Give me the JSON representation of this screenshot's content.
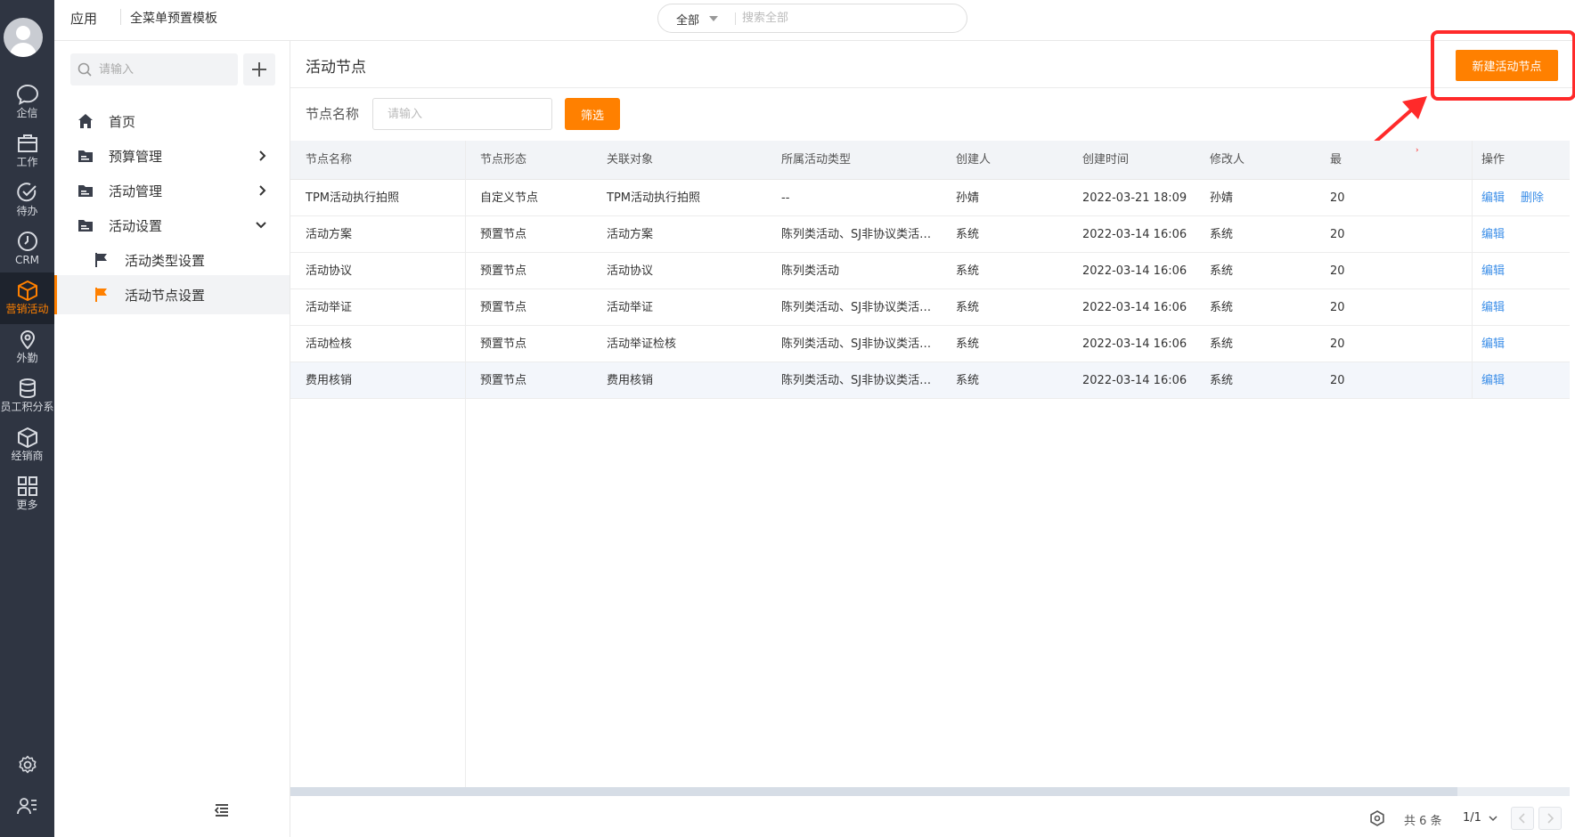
{
  "rail": {
    "items": [
      {
        "label": "企信",
        "icon": "chat-icon"
      },
      {
        "label": "工作",
        "icon": "briefcase-icon"
      },
      {
        "label": "待办",
        "icon": "check-circle-icon"
      },
      {
        "label": "CRM",
        "icon": "clock-icon"
      },
      {
        "label": "营销活动",
        "icon": "cube-icon",
        "active": true
      },
      {
        "label": "外勤",
        "icon": "location-pin-icon"
      },
      {
        "label": "员工积分系",
        "icon": "database-icon"
      },
      {
        "label": "经销商",
        "icon": "box-icon"
      },
      {
        "label": "更多",
        "icon": "grid-icon"
      }
    ],
    "bottom": [
      "settings-gear-icon",
      "user-list-icon"
    ]
  },
  "topbar": {
    "app_label": "应用",
    "template_label": "全菜单预置模板",
    "search_scope": "全部",
    "search_placeholder": "搜索全部"
  },
  "sidebar": {
    "search_placeholder": "请输入",
    "items": [
      {
        "label": "首页",
        "icon": "home-icon"
      },
      {
        "label": "预算管理",
        "icon": "folder-icon",
        "arrow": "right"
      },
      {
        "label": "活动管理",
        "icon": "folder-icon",
        "arrow": "right"
      },
      {
        "label": "活动设置",
        "icon": "folder-icon",
        "arrow": "down"
      },
      {
        "label": "活动类型设置",
        "icon": "flag-icon"
      },
      {
        "label": "活动节点设置",
        "icon": "flag-icon",
        "active": true
      }
    ]
  },
  "main": {
    "title": "活动节点",
    "new_button": "新建活动节点",
    "filter_label": "节点名称",
    "filter_placeholder": "请输入",
    "filter_button": "筛选"
  },
  "table": {
    "columns": [
      "节点名称",
      "节点形态",
      "关联对象",
      "所属活动类型",
      "创建人",
      "创建时间",
      "修改人",
      "最",
      "操作"
    ],
    "rows": [
      {
        "name": "TPM活动执行拍照",
        "form": "自定义节点",
        "object": "TPM活动执行拍照",
        "type": "--",
        "creator": "孙婧",
        "created": "2022-03-21 18:09",
        "modifier": "孙婧",
        "last": "20",
        "ops": [
          "编辑",
          "删除"
        ]
      },
      {
        "name": "活动方案",
        "form": "预置节点",
        "object": "活动方案",
        "type": "陈列类活动、SJ非协议类活动-...",
        "creator": "系统",
        "created": "2022-03-14 16:06",
        "modifier": "系统",
        "last": "20",
        "ops": [
          "编辑"
        ]
      },
      {
        "name": "活动协议",
        "form": "预置节点",
        "object": "活动协议",
        "type": "陈列类活动",
        "creator": "系统",
        "created": "2022-03-14 16:06",
        "modifier": "系统",
        "last": "20",
        "ops": [
          "编辑"
        ]
      },
      {
        "name": "活动举证",
        "form": "预置节点",
        "object": "活动举证",
        "type": "陈列类活动、SJ非协议类活动-...",
        "creator": "系统",
        "created": "2022-03-14 16:06",
        "modifier": "系统",
        "last": "20",
        "ops": [
          "编辑"
        ]
      },
      {
        "name": "活动检核",
        "form": "预置节点",
        "object": "活动举证检核",
        "type": "陈列类活动、SJ非协议类活动-...",
        "creator": "系统",
        "created": "2022-03-14 16:06",
        "modifier": "系统",
        "last": "20",
        "ops": [
          "编辑"
        ]
      },
      {
        "name": "费用核销",
        "form": "预置节点",
        "object": "费用核销",
        "type": "陈列类活动、SJ非协议类活动-...",
        "creator": "系统",
        "created": "2022-03-14 16:06",
        "modifier": "系统",
        "last": "20",
        "ops": [
          "编辑"
        ],
        "highlighted": true
      }
    ]
  },
  "footer": {
    "total": "共 6 条",
    "page": "1/1"
  },
  "colors": {
    "accent": "#ff8000",
    "rail_bg": "#2f3542",
    "link": "#3d8fe8",
    "annotation": "#ff2a2a"
  }
}
